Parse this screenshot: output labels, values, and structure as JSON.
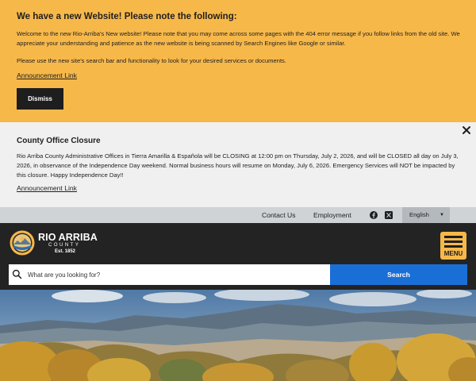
{
  "announcement": {
    "title": "We have a new Website! Please note the following:",
    "para1": "Welcome to the new Rio-Arriba's New website! Please note that you may come across some pages with the 404 error message if you follow links from the old site. We appreciate your understanding and patience as the new website is being scanned by Search Engines like Google or similar.",
    "para2": "Please use the new site's search bar and functionality to look for your desired services or documents.",
    "link": "Announcement Link",
    "dismiss": "Dismiss"
  },
  "closure": {
    "title": "County Office Closure",
    "body": "Rio Arriba County Administrative Offices in Tierra Amarilla & Española will be CLOSING at 12:00 pm on Thursday, July 2, 2026, and will be CLOSED all day on July 3, 2026, in observance of the Independence Day weekend. Normal business hours will resume on Monday, July 6, 2026. Emergency Services will NOT be impacted by this closure. Happy Independence Day!!",
    "link": "Announcement Link"
  },
  "utility": {
    "contact": "Contact Us",
    "employment": "Employment",
    "language": "English"
  },
  "header": {
    "logo_title": "RIO ARRIBA",
    "logo_sub": "COUNTY",
    "logo_est": "Est. 1852",
    "menu_label": "MENU"
  },
  "search": {
    "placeholder": "What are you looking for?",
    "button": "Search"
  },
  "colors": {
    "accent_yellow": "#f7b84a",
    "search_blue": "#1a6fd6",
    "header_dark": "#232323"
  }
}
